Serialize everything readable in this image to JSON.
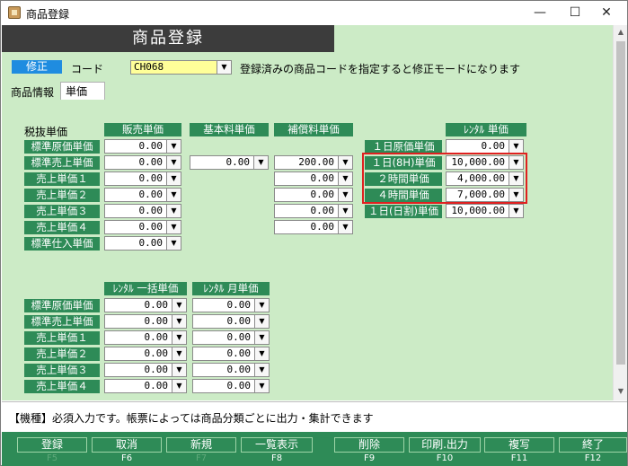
{
  "window": {
    "title": "商品登録",
    "minimize": "—",
    "maximize": "☐",
    "close": "✕"
  },
  "header": {
    "title": "商品登録"
  },
  "mode_badge": "修正",
  "code": {
    "label": "コード",
    "value": "CH068",
    "hint": "登録済みの商品コードを指定すると修正モードになります"
  },
  "tabs": [
    {
      "label": "商品情報"
    },
    {
      "label": "単価"
    }
  ],
  "tax_label": "税抜単価",
  "grid1": {
    "columns": [
      "販売単価",
      "基本料単価",
      "補償料単価"
    ],
    "rows": [
      {
        "label": "標準原価単価",
        "sale": "0.00",
        "basic": "",
        "comp": ""
      },
      {
        "label": "標準売上単価",
        "sale": "0.00",
        "basic": "0.00",
        "comp": "200.00"
      },
      {
        "label": "売上単価１",
        "sale": "0.00",
        "basic": "",
        "comp": "0.00"
      },
      {
        "label": "売上単価２",
        "sale": "0.00",
        "basic": "",
        "comp": "0.00"
      },
      {
        "label": "売上単価３",
        "sale": "0.00",
        "basic": "",
        "comp": "0.00"
      },
      {
        "label": "売上単価４",
        "sale": "0.00",
        "basic": "",
        "comp": "0.00"
      },
      {
        "label": "標準仕入単価",
        "sale": "0.00",
        "basic": "",
        "comp": ""
      }
    ]
  },
  "rental": {
    "header": "ﾚﾝﾀﾙ 単価",
    "rows": [
      {
        "label": "１日原価単価",
        "value": "0.00"
      },
      {
        "label": "１日(8H)単価",
        "value": "10,000.00"
      },
      {
        "label": "２時間単価",
        "value": "4,000.00"
      },
      {
        "label": "４時間単価",
        "value": "7,000.00"
      },
      {
        "label": "１日(日割)単価",
        "value": "10,000.00"
      }
    ]
  },
  "grid2": {
    "columns": [
      "ﾚﾝﾀﾙ 一括単価",
      "ﾚﾝﾀﾙ 月単価"
    ],
    "rows": [
      {
        "label": "標準原価単価",
        "bulk": "0.00",
        "monthly": "0.00"
      },
      {
        "label": "標準売上単価",
        "bulk": "0.00",
        "monthly": "0.00"
      },
      {
        "label": "売上単価１",
        "bulk": "0.00",
        "monthly": "0.00"
      },
      {
        "label": "売上単価２",
        "bulk": "0.00",
        "monthly": "0.00"
      },
      {
        "label": "売上単価３",
        "bulk": "0.00",
        "monthly": "0.00"
      },
      {
        "label": "売上単価４",
        "bulk": "0.00",
        "monthly": "0.00"
      }
    ]
  },
  "message": "【機種】必須入力です。帳票によっては商品分類ごとに出力・集計できます",
  "function_keys": [
    {
      "label": "登録",
      "key": "F5",
      "enabled": false
    },
    {
      "label": "取消",
      "key": "F6",
      "enabled": true
    },
    {
      "label": "新規",
      "key": "F7",
      "enabled": false
    },
    {
      "label": "一覧表示",
      "key": "F8",
      "enabled": true
    },
    {
      "label": "削除",
      "key": "F9",
      "enabled": true
    },
    {
      "label": "印刷.出力",
      "key": "F10",
      "enabled": true
    },
    {
      "label": "複写",
      "key": "F11",
      "enabled": true
    },
    {
      "label": "終了",
      "key": "F12",
      "enabled": true
    }
  ],
  "colors": {
    "green_bg": "#ccebc6",
    "header_green": "#2e8b57",
    "badge_blue": "#1f8ce0",
    "highlight_red": "#e02020"
  }
}
